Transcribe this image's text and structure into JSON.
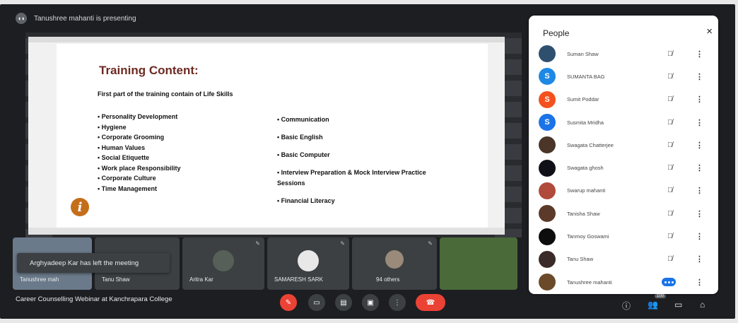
{
  "presenting": {
    "text": "Tanushree mahanti is presenting"
  },
  "slide": {
    "title": "Training Content:",
    "subtitle": "First part of the training contain of Life Skills",
    "left_items": [
      "Personality Development",
      "Hygiene",
      "Corporate Grooming",
      "Human Values",
      "Social Etiquette",
      "Work place Responsibility",
      "Corporate Culture",
      "Time Management"
    ],
    "right_items": [
      "Communication",
      "Basic English",
      "Basic Computer",
      "Interview Preparation & Mock Interview Practice Sessions",
      "Financial Literacy"
    ],
    "logo": "i"
  },
  "people": {
    "title": "People",
    "close": "×",
    "list": [
      {
        "name": "Suman Shaw",
        "initial": "",
        "color": "#2f4f6f"
      },
      {
        "name": "SUMANTA BAG",
        "initial": "S",
        "color": "#1e88e5"
      },
      {
        "name": "Sumit Poddar",
        "initial": "S",
        "color": "#f4511e"
      },
      {
        "name": "Susmita Mridha",
        "initial": "S",
        "color": "#1a73e8"
      },
      {
        "name": "Swagata Chatterjee",
        "initial": "",
        "color": "#4a3528"
      },
      {
        "name": "Swagata ghosh",
        "initial": "",
        "color": "#101018"
      },
      {
        "name": "Swarup mahanti",
        "initial": "",
        "color": "#b04a3a"
      },
      {
        "name": "Tanisha Shaw",
        "initial": "",
        "color": "#5b3a2a"
      },
      {
        "name": "Tanmoy Goswami",
        "initial": "",
        "color": "#0d0d0d"
      },
      {
        "name": "Tanu Shaw",
        "initial": "",
        "color": "#3a2a2a"
      },
      {
        "name": "Tanushree mahanti",
        "initial": "",
        "color": "#6b4a2a"
      }
    ]
  },
  "tiles": [
    {
      "name": "Tanushree mah",
      "color": "#6b7a8a"
    },
    {
      "name": "Tanu Shaw",
      "color": "#3c4043"
    },
    {
      "name": "Aritra Kar",
      "color": "#566058"
    },
    {
      "name": "SAMARESH SARK",
      "color": "#e8e8e8"
    },
    {
      "name": "94 others",
      "color": "#9a8a7a"
    }
  ],
  "toast": "Arghyadeep Kar has left the meeting",
  "meeting_title": "Career Counselling Webinar at Kanchrapara College",
  "participant_count": "100",
  "icons": {
    "mic": "microphone-muted-icon",
    "cam": "camera-icon",
    "cc": "captions-icon",
    "present": "present-icon",
    "more": "more-vert-icon",
    "end": "end-call-icon"
  }
}
